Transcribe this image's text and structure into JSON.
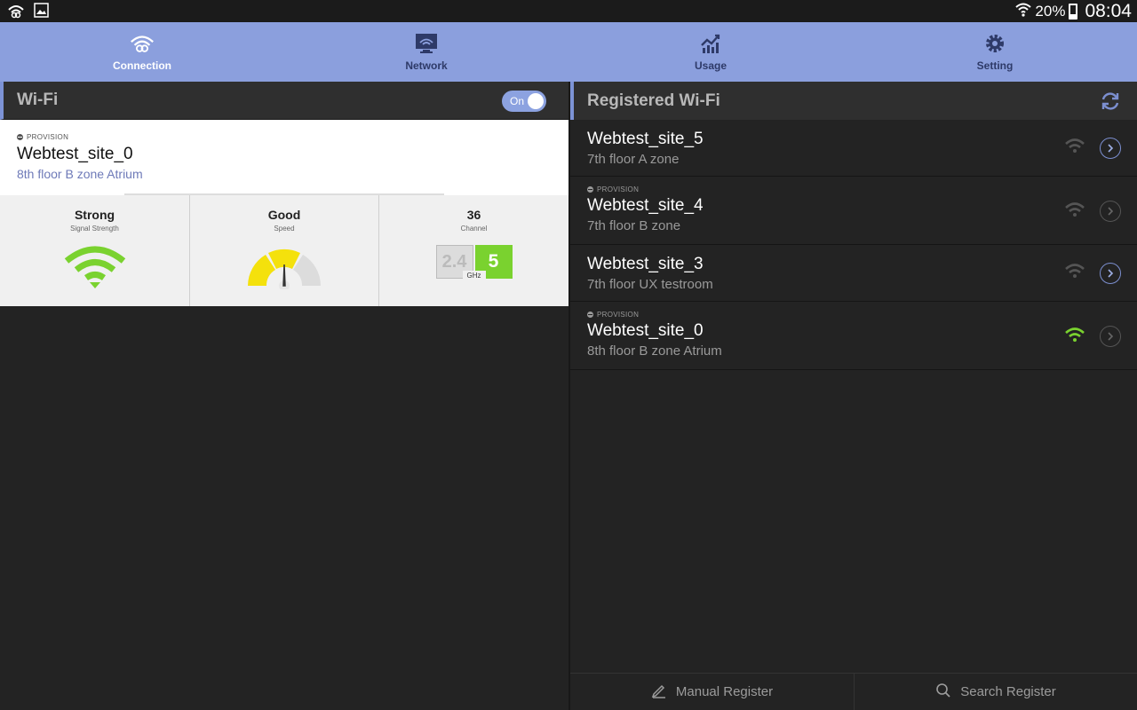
{
  "status_bar": {
    "battery": "20%",
    "time": "08:04"
  },
  "tabs": [
    {
      "label": "Connection",
      "icon": "connection-icon",
      "active": true
    },
    {
      "label": "Network",
      "icon": "monitor-icon",
      "active": false
    },
    {
      "label": "Usage",
      "icon": "chart-icon",
      "active": false
    },
    {
      "label": "Setting",
      "icon": "gear-icon",
      "active": false
    }
  ],
  "wifi_panel": {
    "title": "Wi-Fi",
    "toggle_label": "On",
    "current": {
      "tag": "PROVISION",
      "ssid": "Webtest_site_0",
      "location": "8th floor B zone Atrium"
    },
    "stats": {
      "signal_value": "Strong",
      "signal_label": "Signal Strength",
      "speed_value": "Good",
      "speed_label": "Speed",
      "channel_value": "36",
      "channel_label": "Channel",
      "band_inactive": "2.4",
      "band_active": "5",
      "band_unit": "GHz"
    }
  },
  "registered_panel": {
    "title": "Registered Wi-Fi",
    "networks": [
      {
        "ssid": "Webtest_site_5",
        "location": "7th floor A zone",
        "tag": "",
        "connected": false
      },
      {
        "ssid": "Webtest_site_4",
        "location": "7th floor B zone",
        "tag": "PROVISION",
        "connected": false
      },
      {
        "ssid": "Webtest_site_3",
        "location": "7th floor UX testroom",
        "tag": "",
        "connected": false
      },
      {
        "ssid": "Webtest_site_0",
        "location": "8th floor B zone Atrium",
        "tag": "PROVISION",
        "connected": true
      }
    ],
    "manual_register": "Manual Register",
    "search_register": "Search Register"
  },
  "colors": {
    "accent": "#8b9fdd",
    "wifi_active": "#7ad22f",
    "speed_gauge": "#f4e10c"
  }
}
